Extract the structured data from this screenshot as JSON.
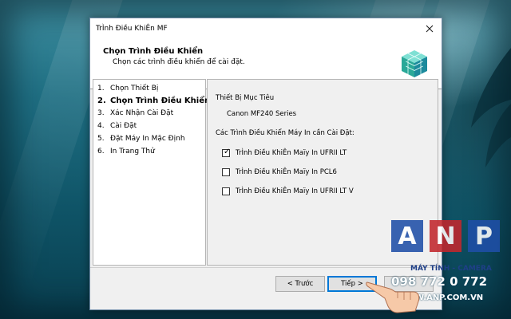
{
  "window": {
    "title": "TrÌnh Điều KhiÊn MF"
  },
  "header": {
    "title": "Chọn Trình Điều Khiển",
    "subtitle": "Chọn các trình điều khiển để cài đặt."
  },
  "steps": [
    {
      "num": "1.",
      "label": "Chọn Thiết Bị",
      "active": false
    },
    {
      "num": "2.",
      "label": "Chọn Trình Điều Khiển",
      "active": true
    },
    {
      "num": "3.",
      "label": "Xác Nhận Cài Đặt",
      "active": false
    },
    {
      "num": "4.",
      "label": "Cài Đặt",
      "active": false
    },
    {
      "num": "5.",
      "label": "Đặt Máy In Mặc Định",
      "active": false
    },
    {
      "num": "6.",
      "label": "In Trang Thử",
      "active": false
    }
  ],
  "main": {
    "target_label": "Thiết Bị Mục Tiêu",
    "target_device": "Canon MF240 Series",
    "drivers_label": "Các Trình Điều Khiển Máy In cần Cài Đặt:",
    "drivers": [
      {
        "label": "TrÌnh Điều KhiÊn Maïy In UFRII LT",
        "checked": true
      },
      {
        "label": "TrÌnh Điều KhiÊn Maïy In PCL6",
        "checked": false
      },
      {
        "label": "TrÌnh Điều KhiÊn Maïy In UFRII LT V",
        "checked": false
      }
    ]
  },
  "buttons": {
    "back": "< Trước",
    "next": "Tiếp >"
  },
  "overlay": {
    "letters": [
      "A",
      "N",
      "P"
    ],
    "line1": "MÁY TÍNH - CAMERA",
    "phone": "098 772 0 772",
    "website": "WWW.ANP.COM.VN",
    "colors": {
      "a": "#1f4fa8",
      "n": "#c2272d",
      "p": "#1f4fa8"
    }
  }
}
